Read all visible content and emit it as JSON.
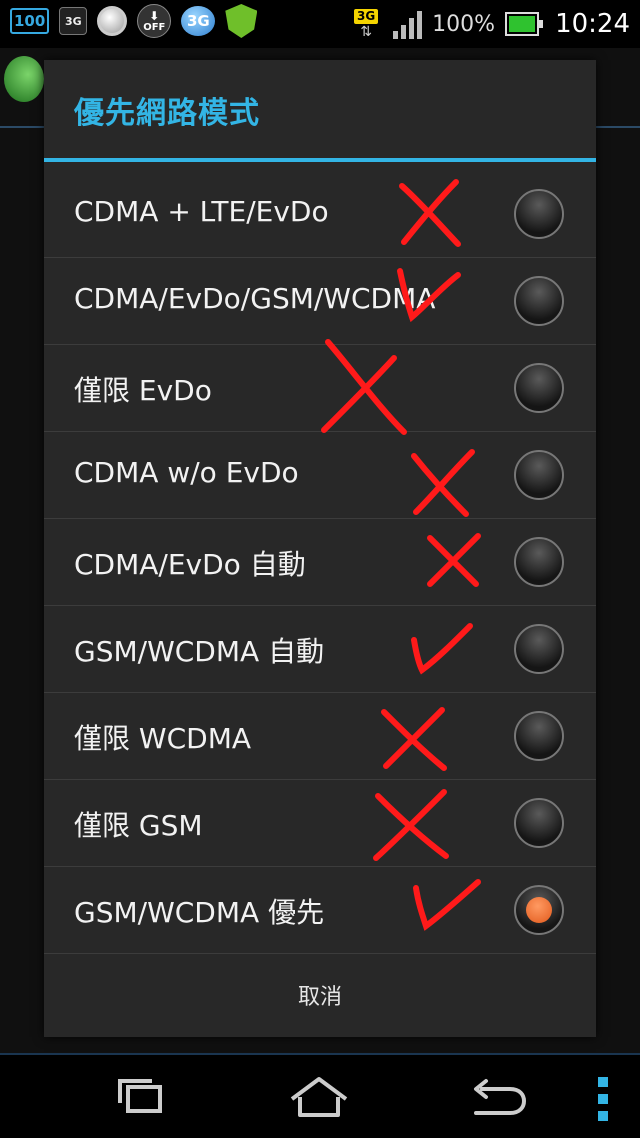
{
  "status_bar": {
    "left_icons": [
      {
        "name": "battery-100-icon",
        "text": "100"
      },
      {
        "name": "sim-3g-icon",
        "text": "3G"
      },
      {
        "name": "circle-app-icon",
        "text": ""
      },
      {
        "name": "download-off-icon",
        "text": "OFF"
      },
      {
        "name": "3g-app-icon",
        "text": "3G"
      },
      {
        "name": "shield-app-icon",
        "text": ""
      }
    ],
    "network_type": "3G",
    "battery_percent": "100%",
    "time": "10:24"
  },
  "dialog": {
    "title": "優先網路模式",
    "options": [
      {
        "label": "CDMA + LTE/EvDo",
        "checked": false,
        "annotation": "x"
      },
      {
        "label": "CDMA/EvDo/GSM/WCDMA",
        "checked": false,
        "annotation": "check"
      },
      {
        "label": "僅限 EvDo",
        "checked": false,
        "annotation": "x"
      },
      {
        "label": "CDMA w/o EvDo",
        "checked": false,
        "annotation": "x"
      },
      {
        "label": "CDMA/EvDo 自動",
        "checked": false,
        "annotation": "x"
      },
      {
        "label": "GSM/WCDMA 自動",
        "checked": false,
        "annotation": "check"
      },
      {
        "label": "僅限 WCDMA",
        "checked": false,
        "annotation": "x"
      },
      {
        "label": "僅限 GSM",
        "checked": false,
        "annotation": "x"
      },
      {
        "label": "GSM/WCDMA 優先",
        "checked": true,
        "annotation": "check"
      }
    ],
    "cancel_label": "取消"
  },
  "colors": {
    "accent": "#33b5e5",
    "annotation_red": "#ff1a1a",
    "radio_selected": "#e8642a"
  },
  "nav_bar": {
    "buttons": [
      "recent-apps-icon",
      "home-icon",
      "back-icon",
      "menu-icon"
    ]
  }
}
